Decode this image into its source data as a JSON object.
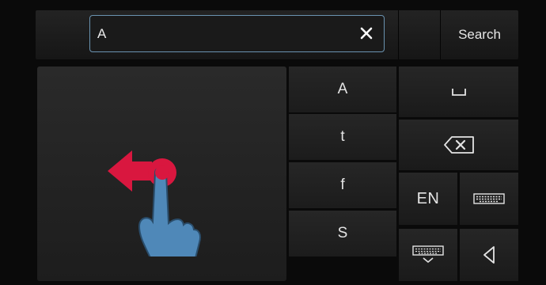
{
  "search_field": {
    "value": "A",
    "clear_icon": "close-icon"
  },
  "search_button": {
    "label": "Search"
  },
  "handwriting_pad": {
    "gesture_icon": "swipe-left-hand-icon",
    "colors": {
      "arrow": "#d9173f",
      "hand": "#4f88b8",
      "hand_outline": "#2a4d6b"
    }
  },
  "suggestions": [
    "A",
    "t",
    "f",
    "S"
  ],
  "keys": {
    "space_icon": "space-icon",
    "backspace_icon": "backspace-icon",
    "language_label": "EN",
    "keyboard_icon": "keyboard-icon",
    "hide_keyboard_icon": "keyboard-hide-icon",
    "back_icon": "back-triangle-icon"
  },
  "colors": {
    "focus_border": "#6a93b0",
    "background": "#0a0a0a"
  }
}
